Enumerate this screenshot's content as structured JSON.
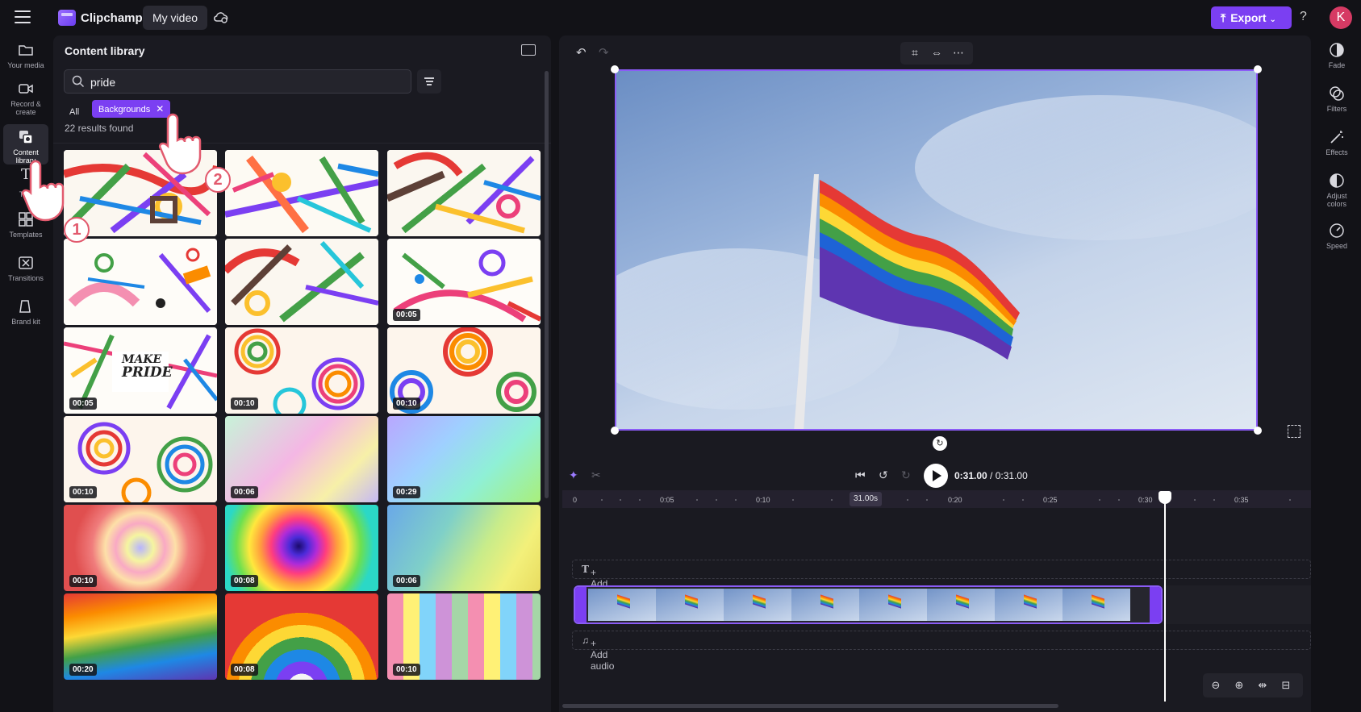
{
  "app": {
    "name": "Clipchamp",
    "project": "My video",
    "export_label": "Export",
    "help": "?",
    "avatar_initial": "K"
  },
  "leftnav": [
    {
      "label1": "Your media",
      "label2": ""
    },
    {
      "label1": "Record &",
      "label2": "create"
    },
    {
      "label1": "Content",
      "label2": "library"
    },
    {
      "label1": "Text",
      "label2": ""
    },
    {
      "label1": "Templates",
      "label2": ""
    },
    {
      "label1": "Transitions",
      "label2": ""
    },
    {
      "label1": "Brand kit",
      "label2": ""
    }
  ],
  "library": {
    "title": "Content library",
    "search_value": "pride",
    "chip_all": "All",
    "chip_active": "Backgrounds",
    "chip_close": "✕",
    "results": "22 results found",
    "thumbs": [
      {
        "duration": ""
      },
      {
        "duration": ""
      },
      {
        "duration": ""
      },
      {
        "duration": ""
      },
      {
        "duration": ""
      },
      {
        "duration": "00:05"
      },
      {
        "duration": "00:05"
      },
      {
        "duration": "00:10"
      },
      {
        "duration": "00:10"
      },
      {
        "duration": "00:10"
      },
      {
        "duration": "00:06"
      },
      {
        "duration": "00:29"
      },
      {
        "duration": "00:10"
      },
      {
        "duration": "00:08"
      },
      {
        "duration": "00:06"
      },
      {
        "duration": "00:20"
      },
      {
        "duration": "00:08"
      },
      {
        "duration": "00:10"
      }
    ],
    "thumb_overlay_text": [
      "MAKE",
      "PRIDE"
    ]
  },
  "timeline": {
    "current": "0:31.00",
    "separator": " / ",
    "total": "0:31.00",
    "ruler": [
      "0",
      "0:05",
      "0:10",
      "0:20",
      "0:25",
      "0:30",
      "0:35"
    ],
    "cursor_badge": "31.00s",
    "add_text": "+ Add text",
    "add_audio": "+ Add audio"
  },
  "rightnav": [
    {
      "label1": "Fade",
      "label2": ""
    },
    {
      "label1": "Filters",
      "label2": ""
    },
    {
      "label1": "Effects",
      "label2": ""
    },
    {
      "label1": "Adjust",
      "label2": "colors"
    },
    {
      "label1": "Speed",
      "label2": ""
    }
  ],
  "steps": [
    "1",
    "2"
  ],
  "colors": {
    "accent": "#7b3ff2",
    "selection": "#8b5cf6",
    "bg": "#121217",
    "panel": "#1a1a21"
  }
}
